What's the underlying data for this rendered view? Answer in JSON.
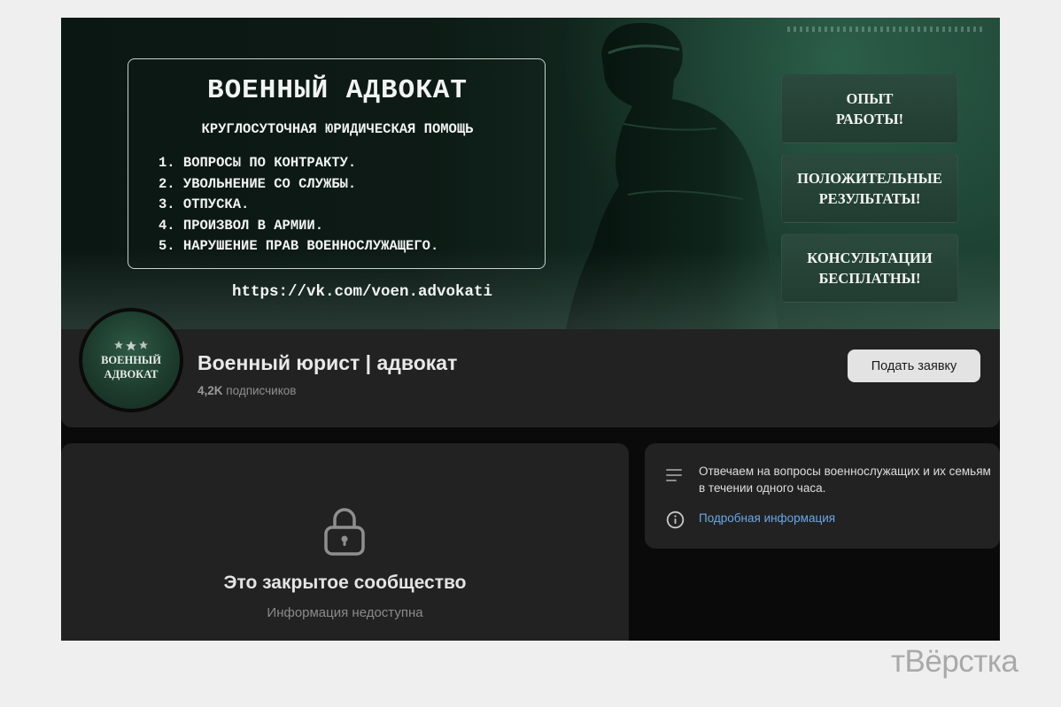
{
  "cover": {
    "title": "ВОЕННЫЙ АДВОКАТ",
    "subtitle": "КРУГЛОСУТОЧНАЯ ЮРИДИЧЕСКАЯ ПОМОЩЬ",
    "items": [
      "1. ВОПРОСЫ ПО КОНТРАКТУ.",
      "2. УВОЛЬНЕНИЕ СО СЛУЖБЫ.",
      "3. ОТПУСКА.",
      "4. ПРОИЗВОЛ В АРМИИ.",
      "5. НАРУШЕНИЕ ПРАВ ВОЕННОСЛУЖАЩЕГО."
    ],
    "url": "https://vk.com/voen.advokati",
    "badges": [
      "ОПЫТ\nРАБОТЫ!",
      "ПОЛОЖИТЕЛЬНЫЕ\nРЕЗУЛЬТАТЫ!",
      "КОНСУЛЬТАЦИИ\nБЕСПЛАТНЫ!"
    ]
  },
  "avatar": {
    "text": "ВОЕННЫЙ\nАДВОКАТ"
  },
  "group": {
    "title": "Военный юрист | адвокат",
    "subscribers_count": "4,2K",
    "subscribers_label": "подписчиков",
    "apply_button": "Подать заявку"
  },
  "closed": {
    "title": "Это закрытое сообщество",
    "subtitle": "Информация недоступна"
  },
  "description": {
    "text": "Отвечаем на вопросы военнослужащих и их семьям в течении одного часа.",
    "link": "Подробная информация"
  },
  "watermark": "тВёрстка",
  "colors": {
    "page_bg": "#efefef",
    "panel_bg": "#222222",
    "link": "#6ba7e8",
    "button_bg": "#e3e3e3"
  }
}
